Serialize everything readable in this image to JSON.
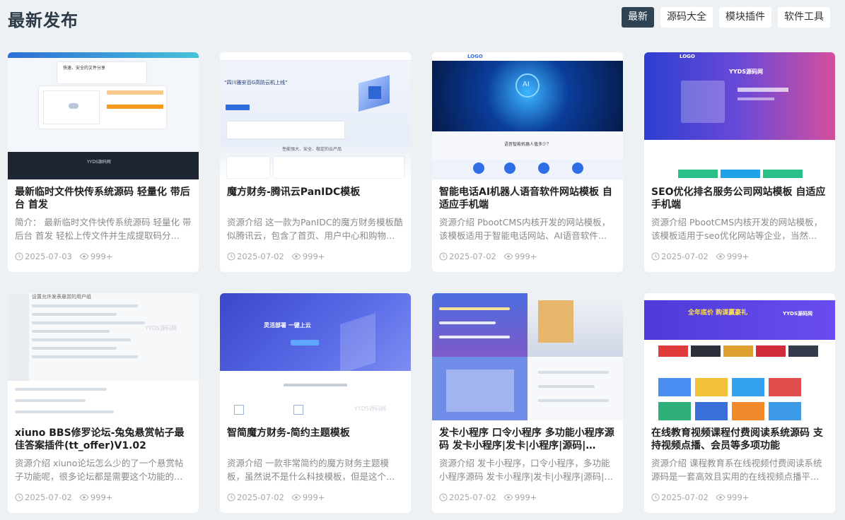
{
  "header": {
    "title": "最新发布",
    "tabs": [
      {
        "label": "最新",
        "active": true
      },
      {
        "label": "源码大全",
        "active": false
      },
      {
        "label": "模块插件",
        "active": false
      },
      {
        "label": "软件工具",
        "active": false
      }
    ]
  },
  "cards": [
    {
      "title": "最新临时文件快传系统源码 轻量化 带后台 首发",
      "desc": "简介： 最新临时文件快传系统源码 轻量化 带后台 首发 轻松上传文件并生成提取码分…",
      "date": "2025-07-03",
      "views": "999+",
      "thumb": {
        "header": "快速、安全的文件分享",
        "brand": "YYDS源码网"
      }
    },
    {
      "title": "魔方财务-腾讯云PanIDC模板",
      "desc": "资源介绍 这一款为PanIDC的魔方财务模板酷似腾讯云，包含了首页、用户中心和购物…",
      "date": "2025-07-02",
      "views": "999+",
      "thumb": {
        "header": "“四川雅安百G高防云机上线”",
        "brand": "性能强大、安全、稳定的云产品"
      }
    },
    {
      "title": "智能电话AI机器人语音软件网站模板 自适应手机端",
      "desc": "资源介绍 PbootCMS内核开发的网站模板，该模板适用于智能电话网站、AI语音软件…",
      "date": "2025-07-02",
      "views": "999+",
      "thumb": {
        "header": "LOGO",
        "brand": "语音智能机器人值多少？"
      }
    },
    {
      "title": "SEO优化排名服务公司网站模板 自适应手机端",
      "desc": "资源介绍 PbootCMS内核开发的网站模板，该模板适用于seo优化网站等企业，当然…",
      "date": "2025-07-02",
      "views": "999+",
      "thumb": {
        "header": "LOGO",
        "brand": "YYDS源码网"
      }
    },
    {
      "title": "xiuno BBS修罗论坛-兔兔悬赏帖子最佳答案插件(tt_offer)V1.02",
      "desc": "资源介绍 xiuno论坛怎么少的了一个悬赏帖子功能呢，很多论坛都是需要这个功能的…",
      "date": "2025-07-02",
      "views": "999+",
      "thumb": {
        "header": "设置允许发表悬赏的用户组",
        "brand": "YYDS源码网"
      }
    },
    {
      "title": "智简魔方财务-简约主题模板",
      "desc": "资源介绍 一款非常简约的魔方财务主题模板，虽然说不是什么科技模板，但是这个…",
      "date": "2025-07-02",
      "views": "999+",
      "thumb": {
        "header": "灵活部署    一键上云",
        "brand": "YYDS源码网"
      }
    },
    {
      "title": "发卡小程序 口令小程序 多功能小程序源码 发卡小程序|发卡|小程序|源码|…",
      "desc": "资源介绍 发卡小程序，口令小程序，多功能小程序源码 发卡小程序|发卡|小程序|源码|…",
      "date": "2025-07-02",
      "views": "999+",
      "thumb": {
        "header": "",
        "brand": ""
      }
    },
    {
      "title": "在线教育视频课程付费阅读系统源码 支持视频点播、会员等多项功能",
      "desc": "资源介绍 课程教育系在线视频付费阅读系统源码是一套高效且实用的在线视频点播平…",
      "date": "2025-07-02",
      "views": "999+",
      "thumb": {
        "header": "全年底价 购课赢豪礼",
        "brand": "YYDS源码网"
      }
    }
  ]
}
